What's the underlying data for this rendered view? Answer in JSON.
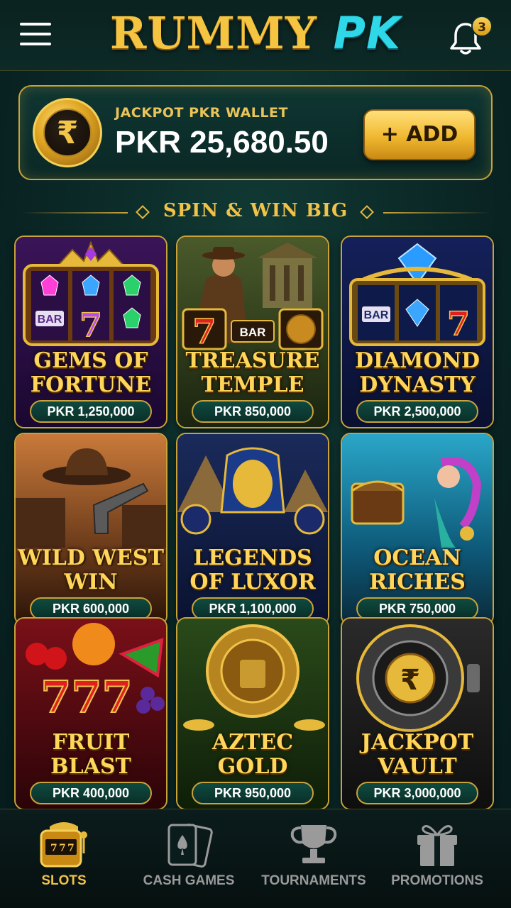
{
  "header": {
    "logo_part1": "RUMMY",
    "logo_part2": "PK",
    "notification_count": "3"
  },
  "wallet": {
    "label": "JACKPOT PKR WALLET",
    "amount": "PKR 25,680.50",
    "currency_symbol": "₹",
    "add_button": "+ ADD"
  },
  "section": {
    "title": "SPIN & WIN BIG"
  },
  "games": [
    {
      "title": "GEMS OF FORTUNE",
      "line1": "GEMS OF",
      "line2": "FORTUNE",
      "prize": "PKR 1,250,000"
    },
    {
      "title": "TREASURE TEMPLE",
      "line1": "TREASURE",
      "line2": "TEMPLE",
      "prize": "PKR 850,000"
    },
    {
      "title": "DIAMOND DYNASTY",
      "line1": "DIAMOND",
      "line2": "DYNASTY",
      "prize": "PKR 2,500,000"
    },
    {
      "title": "WILD WEST WIN",
      "line1": "WILD WEST",
      "line2": "WIN",
      "prize": "PKR 600,000"
    },
    {
      "title": "LEGENDS OF LUXOR",
      "line1": "LEGENDS",
      "line2": "OF LUXOR",
      "prize": "PKR 1,100,000"
    },
    {
      "title": "OCEAN RICHES",
      "line1": "OCEAN",
      "line2": "RICHES",
      "prize": "PKR 750,000"
    },
    {
      "title": "FRUIT BLAST",
      "line1": "FRUIT",
      "line2": "BLAST",
      "prize": "PKR 400,000"
    },
    {
      "title": "AZTEC GOLD",
      "line1": "AZTEC",
      "line2": "GOLD",
      "prize": "PKR 950,000"
    },
    {
      "title": "JACKPOT VAULT",
      "line1": "JACKPOT",
      "line2": "VAULT",
      "prize": "PKR 3,000,000"
    }
  ],
  "reel_text": {
    "bar": "BAR",
    "seven": "7",
    "triple_seven": "777",
    "rupee": "₹"
  },
  "nav": [
    {
      "label": "SLOTS",
      "icon": "slot-machine-icon",
      "active": true
    },
    {
      "label": "CASH GAMES",
      "icon": "playing-cards-icon",
      "active": false
    },
    {
      "label": "TOURNAMENTS",
      "icon": "trophy-icon",
      "active": false
    },
    {
      "label": "PROMOTIONS",
      "icon": "gift-icon",
      "active": false
    }
  ],
  "colors": {
    "accent_gold": "#f0c24a",
    "accent_cyan": "#2fd8e8",
    "background": "#0b2a28"
  }
}
